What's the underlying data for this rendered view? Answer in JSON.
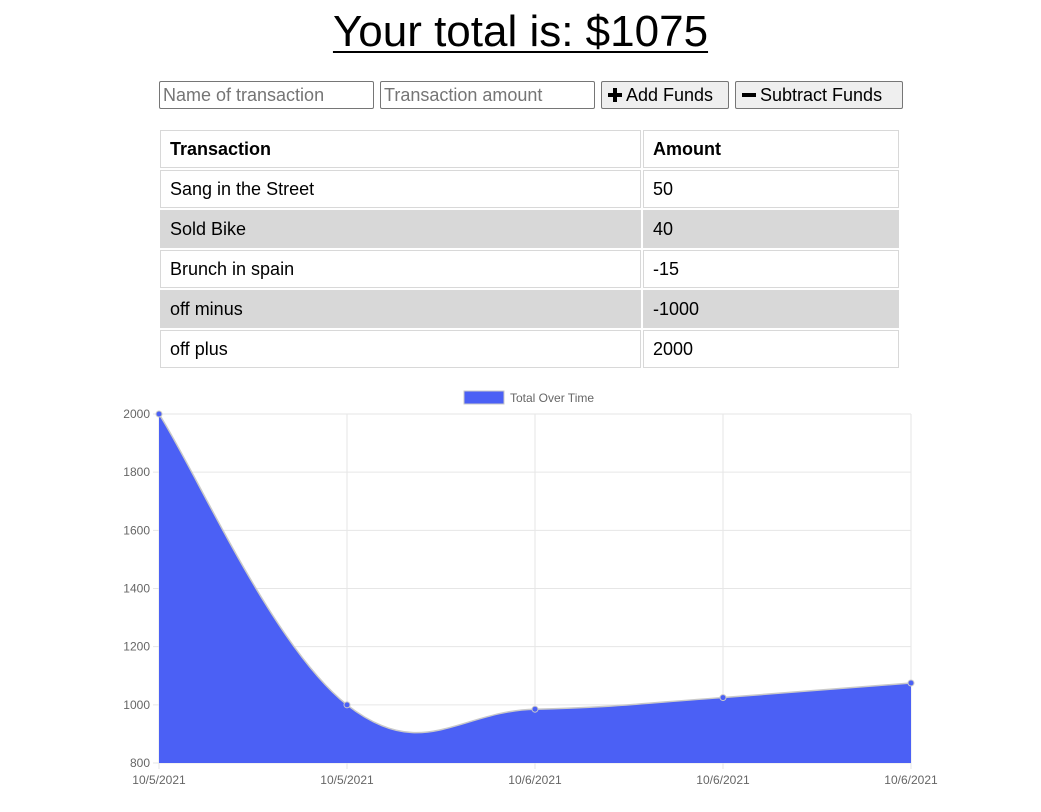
{
  "header": {
    "total_label": "Your total is: $1075"
  },
  "form": {
    "name_placeholder": "Name of transaction",
    "amount_placeholder": "Transaction amount",
    "add_label": "Add Funds",
    "subtract_label": "Subtract Funds",
    "add_icon": "plus-icon",
    "subtract_icon": "minus-icon"
  },
  "table": {
    "headers": [
      "Transaction",
      "Amount"
    ],
    "rows": [
      {
        "name": "Sang in the Street",
        "amount": "50"
      },
      {
        "name": "Sold Bike",
        "amount": "40"
      },
      {
        "name": "Brunch in spain",
        "amount": "-15"
      },
      {
        "name": "off minus",
        "amount": "-1000"
      },
      {
        "name": "off plus",
        "amount": "2000"
      }
    ],
    "stripe_color": "#d8d8d8"
  },
  "chart_data": {
    "type": "area",
    "title": "",
    "xlabel": "",
    "ylabel": "",
    "categories": [
      "10/5/2021",
      "10/5/2021",
      "10/6/2021",
      "10/6/2021",
      "10/6/2021"
    ],
    "series": [
      {
        "name": "Total Over Time",
        "values": [
          2000,
          1000,
          985,
          1025,
          1075
        ],
        "color": "#4b60f5"
      }
    ],
    "ylim": [
      800,
      2000
    ],
    "yticks": [
      800,
      1000,
      1200,
      1400,
      1600,
      1800,
      2000
    ],
    "grid": true,
    "legend": "top-center"
  }
}
